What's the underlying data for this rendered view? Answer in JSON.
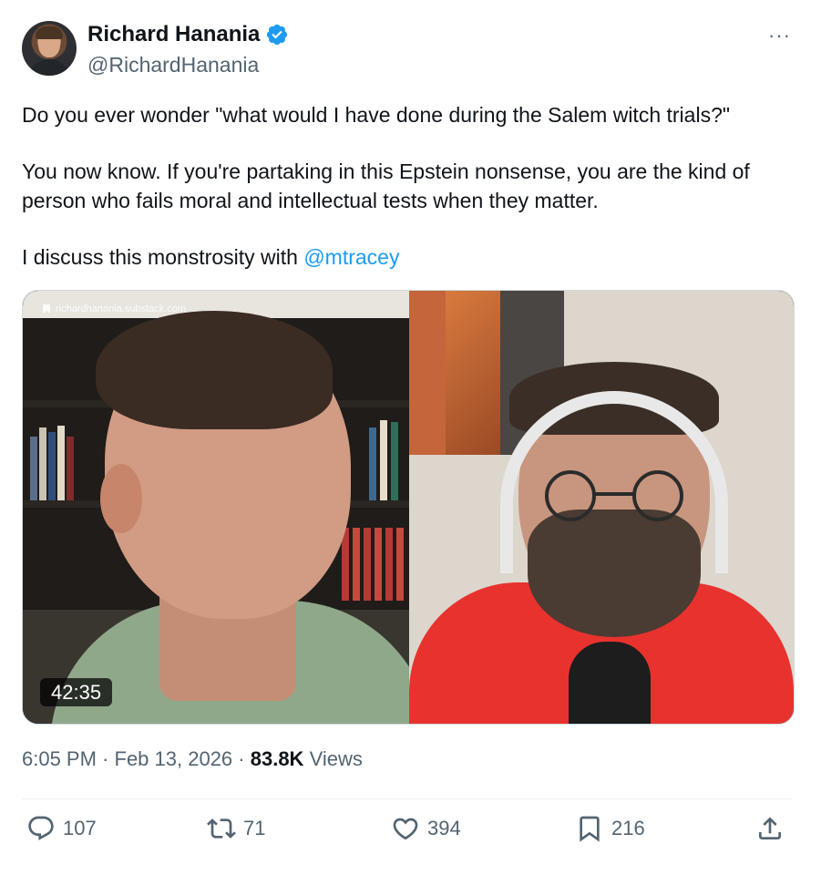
{
  "author": {
    "display_name": "Richard Hanania",
    "handle": "@RichardHanania",
    "verified": true
  },
  "more_menu": "···",
  "tweet": {
    "line1": "Do you ever wonder \"what would I have done during the Salem witch trials?\"",
    "line2": "You now know. If you're partaking in this Epstein nonsense, you are the kind of person who fails moral and intellectual tests when they matter.",
    "line3_prefix": "I discuss this monstrosity with ",
    "mention": "@mtracey"
  },
  "video": {
    "watermark": "richardhanania.substack.com",
    "duration": "42:35"
  },
  "meta": {
    "time": "6:05 PM",
    "date": "Feb 13, 2026",
    "separator": " · ",
    "views_count": "83.8K",
    "views_label": "Views"
  },
  "actions": {
    "replies": "107",
    "retweets": "71",
    "likes": "394",
    "bookmarks": "216"
  },
  "colors": {
    "accent": "#1d9bf0",
    "text": "#0f1419",
    "muted": "#536471"
  }
}
